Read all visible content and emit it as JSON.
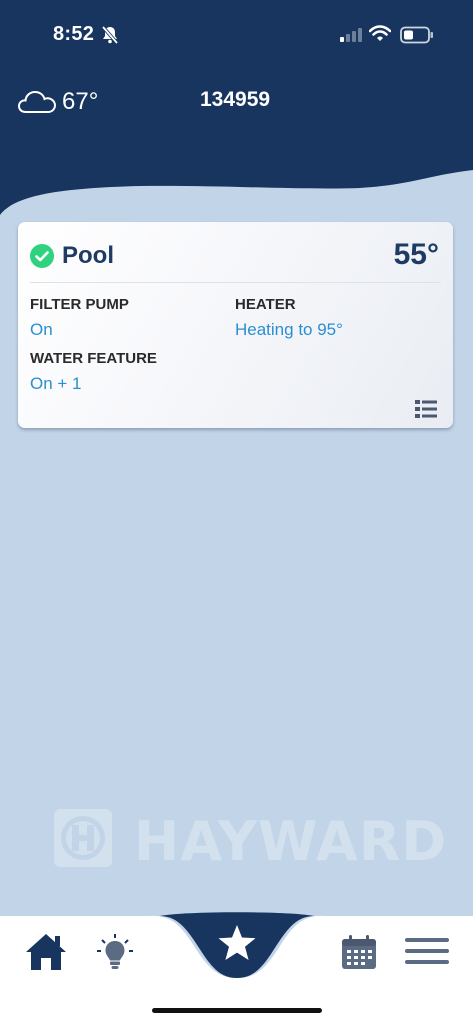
{
  "status_bar": {
    "time": "8:52",
    "icons": [
      "bell-slash-icon",
      "signal-icon",
      "wifi-icon",
      "battery-icon"
    ]
  },
  "header": {
    "weather_icon": "cloud-icon",
    "temperature": "67°",
    "site_id": "134959"
  },
  "pool_card": {
    "status_icon": "check-circle-icon",
    "title": "Pool",
    "temperature": "55°",
    "filter_pump_label": "FILTER PUMP",
    "filter_pump_value": "On",
    "heater_label": "HEATER",
    "heater_value": "Heating to 95°",
    "water_feature_label": "WATER FEATURE",
    "water_feature_value": "On + 1",
    "detail_icon": "list-icon"
  },
  "logo": {
    "text": "HAYWARD"
  },
  "tab_bar": {
    "items": [
      "home-icon",
      "lightbulb-icon",
      "star-icon",
      "calendar-icon",
      "menu-icon"
    ]
  },
  "colors": {
    "header_bg": "#17355e",
    "page_bg": "#c2d4e8",
    "accent_blue": "#2a8fd1",
    "title_navy": "#1f3a63",
    "status_green": "#2fd27f"
  }
}
